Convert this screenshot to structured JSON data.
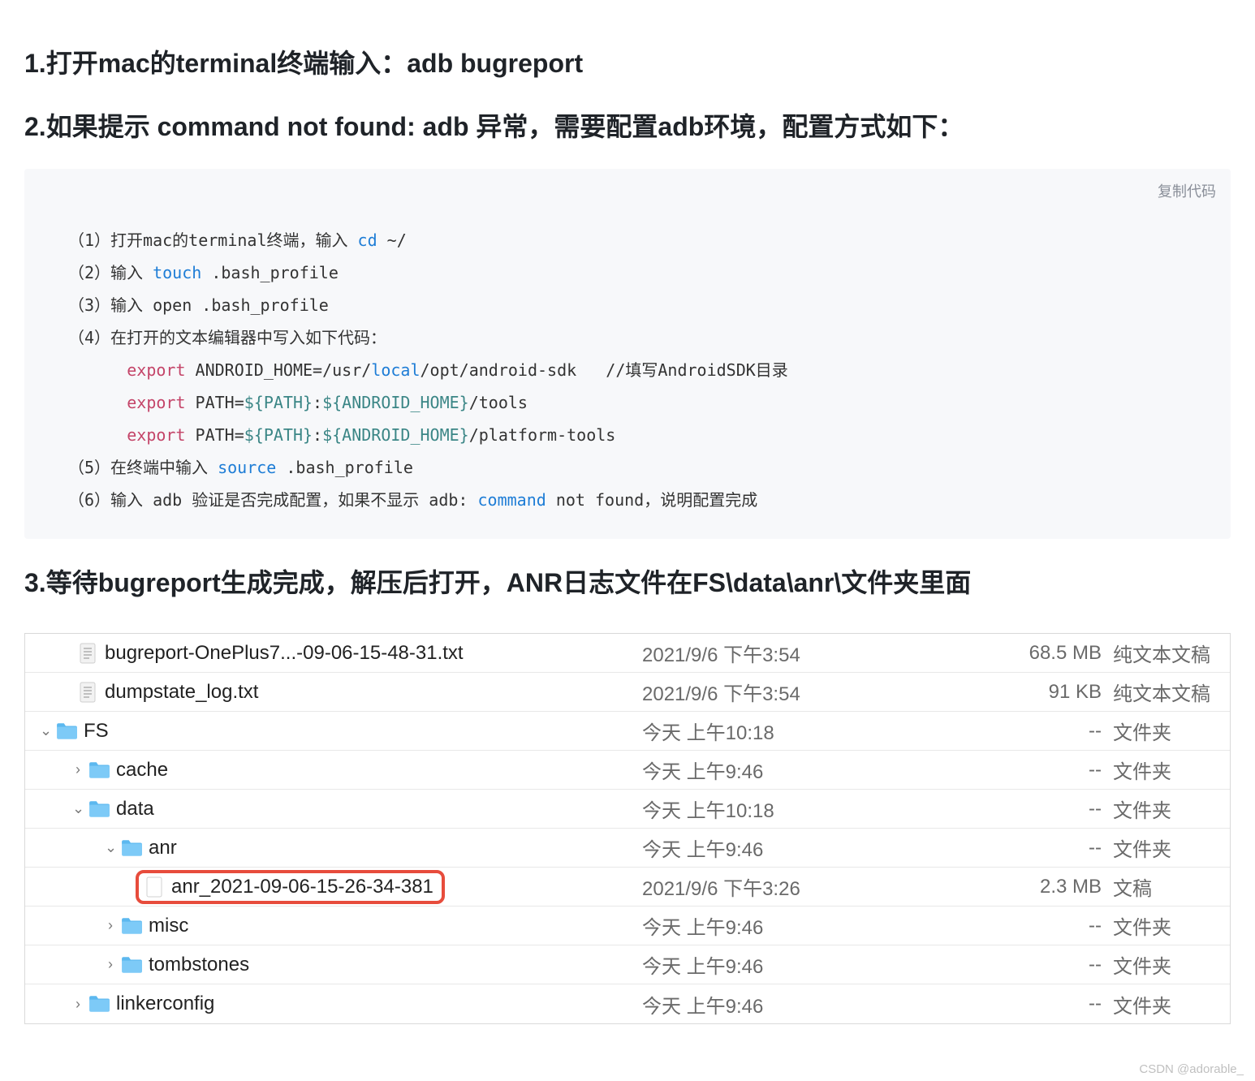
{
  "headings": {
    "step1": "1.打开mac的terminal终端输入：adb bugreport",
    "step2": "2.如果提示 command not found: adb 异常，需要配置adb环境，配置方式如下：",
    "step3": "3.等待bugreport生成完成，解压后打开，ANR日志文件在FS\\data\\anr\\文件夹里面"
  },
  "code": {
    "copy_label": "复制代码",
    "line1_a": "（1）打开mac的terminal终端，输入 ",
    "line1_cmd": "cd",
    "line1_b": " ~/",
    "line2_a": "（2）输入 ",
    "line2_cmd": "touch",
    "line2_b": " .bash_profile",
    "line3": "（3）输入 open .bash_profile",
    "line4": "（4）在打开的文本编辑器中写入如下代码：",
    "line5_kw": "export",
    "line5_b": " ANDROID_HOME=/usr/",
    "line5_cmd": "local",
    "line5_c": "/opt/android-sdk   //填写AndroidSDK目录",
    "line6_kw": "export",
    "line6_b": " PATH=",
    "line6_var1": "${PATH}",
    "line6_c": ":",
    "line6_var2": "${ANDROID_HOME}",
    "line6_d": "/tools",
    "line7_kw": "export",
    "line7_b": " PATH=",
    "line7_var1": "${PATH}",
    "line7_c": ":",
    "line7_var2": "${ANDROID_HOME}",
    "line7_d": "/platform-tools",
    "line8_a": "（5）在终端中输入 ",
    "line8_cmd": "source",
    "line8_b": " .bash_profile",
    "line9_a": "（6）输入 adb 验证是否完成配置，如果不显示 adb: ",
    "line9_cmd": "command",
    "line9_b": " not found，说明配置完成"
  },
  "finder": {
    "rows": [
      {
        "indent": 60,
        "disclosure": "",
        "icon": "txt",
        "name": "bugreport-OnePlus7...-09-06-15-48-31.txt",
        "date": "2021/9/6 下午3:54",
        "size": "68.5 MB",
        "kind": "纯文本文稿",
        "highlighted": false
      },
      {
        "indent": 60,
        "disclosure": "",
        "icon": "txt",
        "name": "dumpstate_log.txt",
        "date": "2021/9/6 下午3:54",
        "size": "91 KB",
        "kind": "纯文本文稿",
        "highlighted": false
      },
      {
        "indent": 18,
        "disclosure": "⌄",
        "icon": "folder",
        "name": "FS",
        "date": "今天 上午10:18",
        "size": "--",
        "kind": "文件夹",
        "highlighted": false
      },
      {
        "indent": 58,
        "disclosure": "›",
        "icon": "folder",
        "name": "cache",
        "date": "今天 上午9:46",
        "size": "--",
        "kind": "文件夹",
        "highlighted": false
      },
      {
        "indent": 58,
        "disclosure": "⌄",
        "icon": "folder",
        "name": "data",
        "date": "今天 上午10:18",
        "size": "--",
        "kind": "文件夹",
        "highlighted": false
      },
      {
        "indent": 98,
        "disclosure": "⌄",
        "icon": "folder",
        "name": "anr",
        "date": "今天 上午9:46",
        "size": "--",
        "kind": "文件夹",
        "highlighted": false
      },
      {
        "indent": 140,
        "disclosure": "",
        "icon": "doc",
        "name": "anr_2021-09-06-15-26-34-381",
        "date": "2021/9/6 下午3:26",
        "size": "2.3 MB",
        "kind": "文稿",
        "highlighted": true
      },
      {
        "indent": 98,
        "disclosure": "›",
        "icon": "folder",
        "name": "misc",
        "date": "今天 上午9:46",
        "size": "--",
        "kind": "文件夹",
        "highlighted": false
      },
      {
        "indent": 98,
        "disclosure": "›",
        "icon": "folder",
        "name": "tombstones",
        "date": "今天 上午9:46",
        "size": "--",
        "kind": "文件夹",
        "highlighted": false
      },
      {
        "indent": 58,
        "disclosure": "›",
        "icon": "folder",
        "name": "linkerconfig",
        "date": "今天 上午9:46",
        "size": "--",
        "kind": "文件夹",
        "highlighted": false
      }
    ]
  },
  "watermark": "CSDN @adorable_"
}
